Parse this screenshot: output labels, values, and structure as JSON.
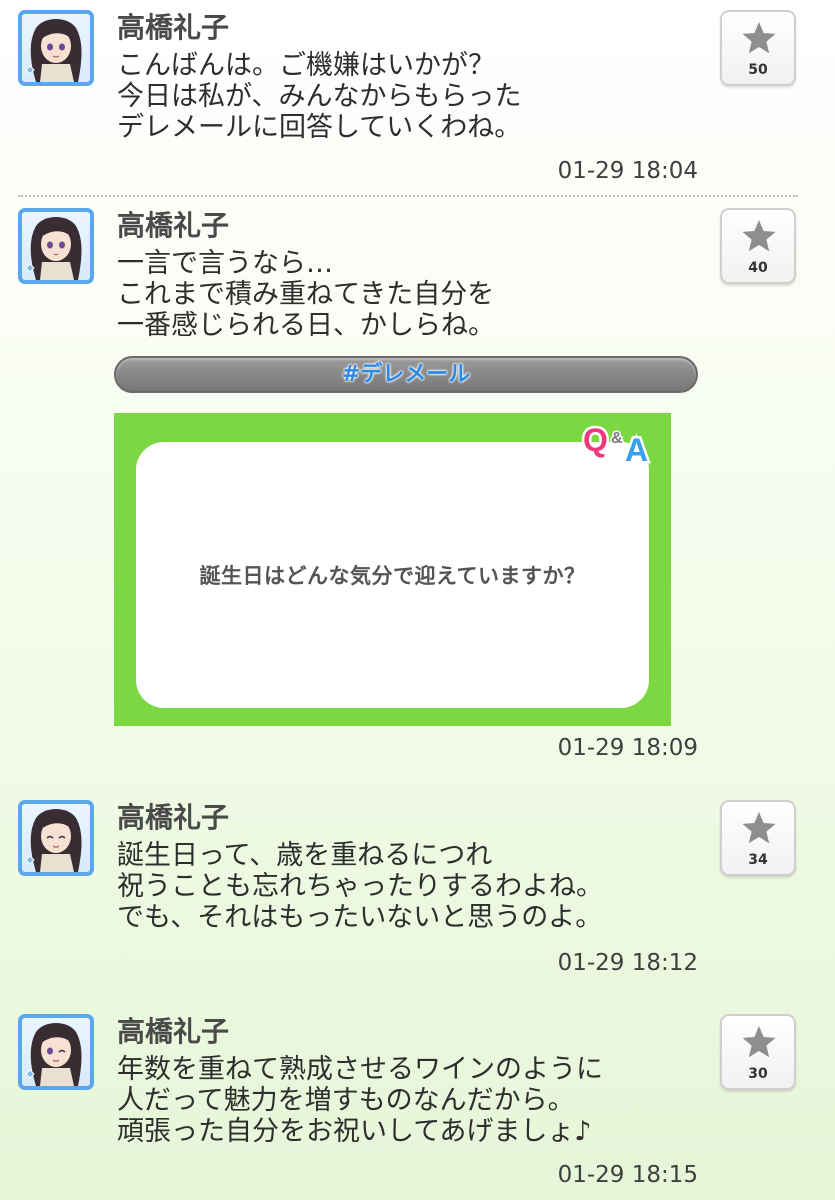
{
  "posts": [
    {
      "author": "高橋礼子",
      "lines": [
        "こんばんは。ご機嫌はいかが？",
        "今日は私が、みんなからもらった",
        "デレメールに回答していくわね。"
      ],
      "timestamp": "01-29 18:04",
      "likes": "50"
    },
    {
      "author": "高橋礼子",
      "lines": [
        "一言で言うなら…",
        "これまで積み重ねてきた自分を",
        "一番感じられる日、かしらね。"
      ],
      "hashtag": "#デレメール",
      "card": {
        "logo": "Q&A",
        "question": "誕生日はどんな気分で迎えていますか？"
      },
      "timestamp": "01-29 18:09",
      "likes": "40"
    },
    {
      "author": "高橋礼子",
      "lines": [
        "誕生日って、歳を重ねるにつれ",
        "祝うことも忘れちゃったりするわよね。",
        "でも、それはもったいないと思うのよ。"
      ],
      "timestamp": "01-29 18:12",
      "likes": "34"
    },
    {
      "author": "高橋礼子",
      "lines": [
        "年数を重ねて熟成させるワインのように",
        "人だって魅力を増すものなんだから。",
        "頑張った自分をお祝いしてあげましょ♪"
      ],
      "timestamp": "01-29 18:15",
      "likes": "30"
    }
  ],
  "icons": {
    "avatar": "character-avatar-icon",
    "like": "star-icon"
  },
  "colors": {
    "avatar_border": "#5aa7ee",
    "hashtag_text": "#2d89e6",
    "qa_card_bg": "#7bd843",
    "qa_q": "#f0397d",
    "qa_a": "#3aa0ec"
  }
}
